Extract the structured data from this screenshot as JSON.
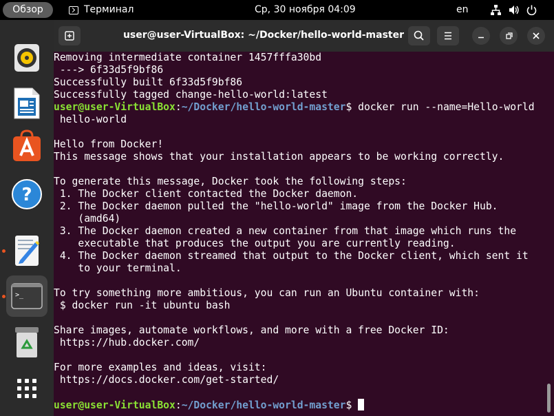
{
  "topbar": {
    "activities": "Обзор",
    "app_name": "Терминал",
    "clock": "Ср, 30 ноября  04:09",
    "language": "en"
  },
  "dock": {
    "items": [
      {
        "name": "rhythmbox-icon"
      },
      {
        "name": "libreoffice-writer-icon"
      },
      {
        "name": "app-center-icon"
      },
      {
        "name": "help-icon"
      },
      {
        "name": "text-editor-icon"
      },
      {
        "name": "terminal-icon"
      },
      {
        "name": "trash-icon"
      },
      {
        "name": "show-apps-icon"
      }
    ]
  },
  "window": {
    "title": "user@user-VirtualBox: ~/Docker/hello-world-master",
    "prompt_user": "user@user-VirtualBox",
    "prompt_path": "~/Docker/hello-world-master",
    "lines": [
      "Removing intermediate container 1457fffa30bd",
      " ---> 6f33d5f9bf86",
      "Successfully built 6f33d5f9bf86",
      "Successfully tagged change-hello-world:latest",
      "",
      " hello-world",
      "",
      "Hello from Docker!",
      "This message shows that your installation appears to be working correctly.",
      "",
      "To generate this message, Docker took the following steps:",
      " 1. The Docker client contacted the Docker daemon.",
      " 2. The Docker daemon pulled the \"hello-world\" image from the Docker Hub.",
      "    (amd64)",
      " 3. The Docker daemon created a new container from that image which runs the",
      "    executable that produces the output you are currently reading.",
      " 4. The Docker daemon streamed that output to the Docker client, which sent it",
      "    to your terminal.",
      "",
      "To try something more ambitious, you can run an Ubuntu container with:",
      " $ docker run -it ubuntu bash",
      "",
      "Share images, automate workflows, and more with a free Docker ID:",
      " https://hub.docker.com/",
      "",
      "For more examples and ideas, visit:",
      " https://docs.docker.com/get-started/",
      "",
      ""
    ],
    "command_line_index": 4,
    "command": "$ docker run --name=Hello-world",
    "final_prompt_index": 28,
    "final_prompt_suffix": "$ "
  }
}
